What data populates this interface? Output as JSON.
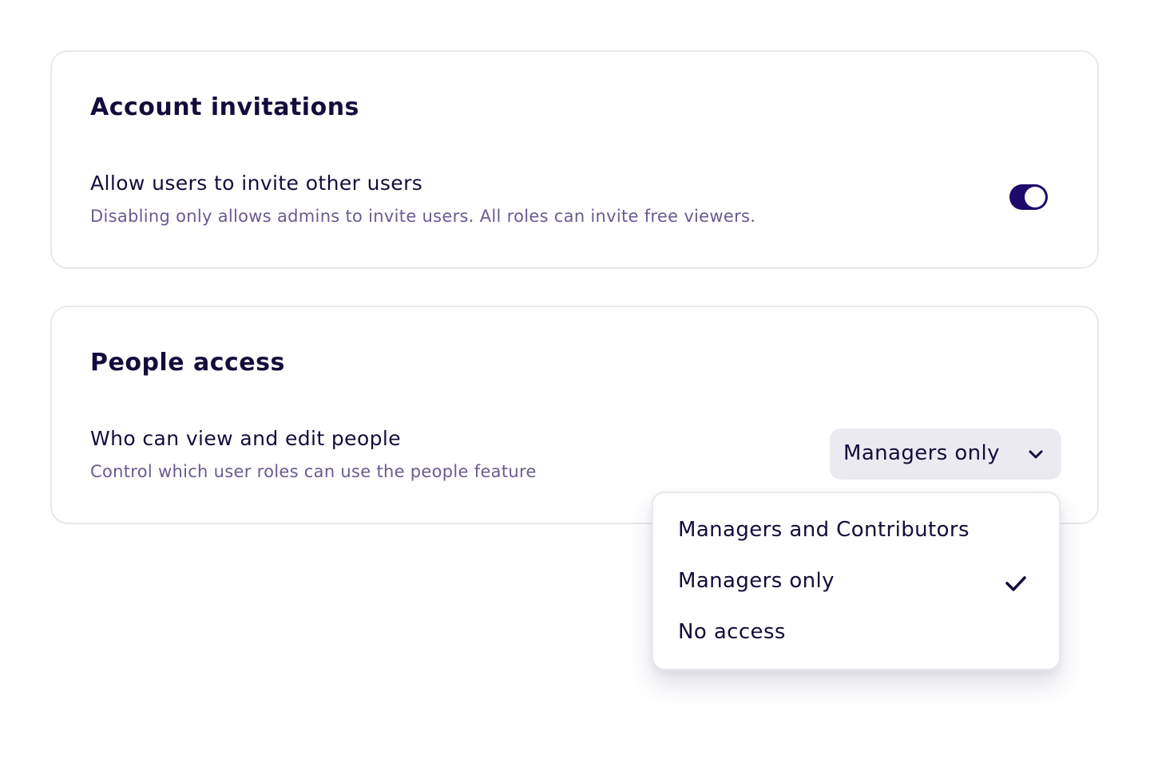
{
  "account_invitations": {
    "title": "Account invitations",
    "setting": {
      "label": "Allow users to invite other users",
      "description": "Disabling only allows admins to invite users. All roles can invite free viewers.",
      "enabled": true
    }
  },
  "people_access": {
    "title": "People access",
    "setting": {
      "label": "Who can view and edit people",
      "description": "Control which user roles can use the people feature",
      "selected_value": "Managers only",
      "chevron_icon": "chevron-down-icon"
    }
  },
  "dropdown": {
    "options": [
      {
        "label": "Managers and Contributors",
        "selected": false
      },
      {
        "label": "Managers only",
        "selected": true
      },
      {
        "label": "No access",
        "selected": false
      }
    ],
    "check_icon": "check-icon"
  },
  "colors": {
    "accent": "#1d0a6b",
    "text_primary": "#120d3b",
    "text_secondary": "#6b5a92",
    "select_bg": "#eceaf1",
    "border": "#e9e8ee"
  }
}
